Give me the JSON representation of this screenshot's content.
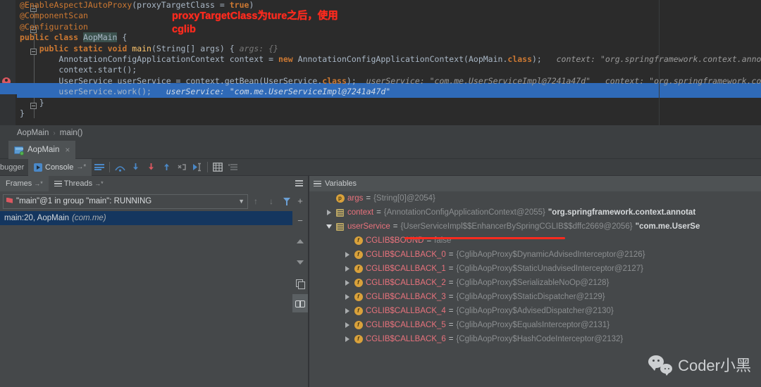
{
  "editor": {
    "lines": [
      {
        "type": "code",
        "tokens": [
          {
            "t": "@EnableAspectJAutoProxy",
            "c": "ann"
          },
          {
            "t": "(proxyTargetClass = ",
            "c": "cls"
          },
          {
            "t": "true",
            "c": "kw"
          },
          {
            "t": ")",
            "c": "cls"
          }
        ],
        "indent": 0
      },
      {
        "type": "code",
        "tokens": [
          {
            "t": "@ComponentScan",
            "c": "ann"
          }
        ],
        "indent": 0
      },
      {
        "type": "code",
        "tokens": [
          {
            "t": "@Configuration",
            "c": "ann"
          }
        ],
        "indent": 0
      },
      {
        "type": "code",
        "tokens": [
          {
            "t": "public class ",
            "c": "kw"
          },
          {
            "t": "AopMain",
            "c": "idh"
          },
          {
            "t": " {",
            "c": "cls"
          }
        ],
        "indent": 0
      },
      {
        "type": "code",
        "tokens": [
          {
            "t": "public static void ",
            "c": "kw"
          },
          {
            "t": "main",
            "c": "fn"
          },
          {
            "t": "(String[] args) { ",
            "c": "cls"
          },
          {
            "t": "args: {}",
            "c": "hint"
          }
        ],
        "indent": 1
      },
      {
        "type": "code",
        "tokens": [
          {
            "t": "AnnotationConfigApplicationContext context = ",
            "c": "cls"
          },
          {
            "t": "new ",
            "c": "kw"
          },
          {
            "t": "AnnotationConfigApplicationContext(AopMain.",
            "c": "cls"
          },
          {
            "t": "class",
            "c": "kw"
          },
          {
            "t": "); ",
            "c": "cls"
          },
          {
            "t": "  context: \"org.springframework.context.annota",
            "c": "hint-w"
          }
        ],
        "indent": 2
      },
      {
        "type": "code",
        "tokens": [
          {
            "t": "context.start();",
            "c": "cls"
          }
        ],
        "indent": 2
      },
      {
        "type": "code",
        "tokens": [
          {
            "t": "UserService userService = context.getBean(UserService.",
            "c": "cls"
          },
          {
            "t": "class",
            "c": "kw"
          },
          {
            "t": "); ",
            "c": "cls"
          },
          {
            "t": " userService: \"com.me.UserServiceImpl@7241a47d\"   context: \"org.springframework.cont",
            "c": "hint-w"
          }
        ],
        "indent": 2
      },
      {
        "type": "highlight",
        "tokens": [
          {
            "t": "userService.work();",
            "c": "cls"
          },
          {
            "t": "   userService: \"com.me.UserServiceImpl@7241a47d\"",
            "c": "hlhint"
          }
        ],
        "indent": 2
      },
      {
        "type": "code",
        "tokens": [
          {
            "t": "}",
            "c": "cls"
          }
        ],
        "indent": 1
      },
      {
        "type": "code",
        "tokens": [
          {
            "t": "}",
            "c": "cls"
          }
        ],
        "indent": 0
      }
    ],
    "annotation": "proxyTargetClass为ture之后，使用\ncglib"
  },
  "breadcrumb": {
    "class_name": "AopMain",
    "separator": "›",
    "method_name": "main()"
  },
  "file_tab": {
    "label": "AopMain",
    "close": "×"
  },
  "debug_toolbar": {
    "left_tab_label": "bugger",
    "console_label": "Console",
    "console_pin": "→*",
    "icons": [
      "lines-icon",
      "step-over-icon",
      "step-into-icon",
      "force-step-into-icon",
      "step-out-icon",
      "drop-frame-icon",
      "run-to-cursor-icon",
      "evaluate-expression-icon",
      "mute-breakpoints-icon"
    ]
  },
  "frames_panel": {
    "tabs": [
      {
        "label": "Frames",
        "pin": "→*",
        "active": true
      },
      {
        "label": "Threads",
        "pin": "→*",
        "active": false
      }
    ],
    "thread_selector": "\"main\"@1 in group \"main\": RUNNING",
    "frame_row": {
      "location": "main:20, AopMain",
      "package": "(com.me)"
    },
    "side_buttons": [
      "+",
      "−",
      "up-arrow",
      "down-arrow",
      "copy-icon",
      "glasses-icon"
    ]
  },
  "variables_panel": {
    "title": "Variables",
    "rows": [
      {
        "indent": 1,
        "expander": "none",
        "icon": "p",
        "name": "args",
        "eq": "=",
        "value": "{String[0]@2054}",
        "string": ""
      },
      {
        "indent": 1,
        "expander": "collapsed",
        "icon": "obj",
        "name": "context",
        "eq": "=",
        "value": "{AnnotationConfigApplicationContext@2055}",
        "string": "\"org.springframework.context.annotat"
      },
      {
        "indent": 1,
        "expander": "expanded",
        "icon": "obj",
        "name": "userService",
        "eq": "=",
        "value": "{UserServiceImpl$$EnhancerBySpringCGLIB$$dffc2669@2056}",
        "string": "\"com.me.UserSe"
      },
      {
        "indent": 2,
        "expander": "none",
        "icon": "f",
        "name": "CGLIB$BOUND",
        "eq": "=",
        "value": "false",
        "string": ""
      },
      {
        "indent": 2,
        "expander": "collapsed",
        "icon": "f",
        "name": "CGLIB$CALLBACK_0",
        "eq": "=",
        "value": "{CglibAopProxy$DynamicAdvisedInterceptor@2126}",
        "string": ""
      },
      {
        "indent": 2,
        "expander": "collapsed",
        "icon": "f",
        "name": "CGLIB$CALLBACK_1",
        "eq": "=",
        "value": "{CglibAopProxy$StaticUnadvisedInterceptor@2127}",
        "string": ""
      },
      {
        "indent": 2,
        "expander": "collapsed",
        "icon": "f",
        "name": "CGLIB$CALLBACK_2",
        "eq": "=",
        "value": "{CglibAopProxy$SerializableNoOp@2128}",
        "string": ""
      },
      {
        "indent": 2,
        "expander": "collapsed",
        "icon": "f",
        "name": "CGLIB$CALLBACK_3",
        "eq": "=",
        "value": "{CglibAopProxy$StaticDispatcher@2129}",
        "string": ""
      },
      {
        "indent": 2,
        "expander": "collapsed",
        "icon": "f",
        "name": "CGLIB$CALLBACK_4",
        "eq": "=",
        "value": "{CglibAopProxy$AdvisedDispatcher@2130}",
        "string": ""
      },
      {
        "indent": 2,
        "expander": "collapsed",
        "icon": "f",
        "name": "CGLIB$CALLBACK_5",
        "eq": "=",
        "value": "{CglibAopProxy$EqualsInterceptor@2131}",
        "string": ""
      },
      {
        "indent": 2,
        "expander": "collapsed",
        "icon": "f",
        "name": "CGLIB$CALLBACK_6",
        "eq": "=",
        "value": "{CglibAopProxy$HashCodeInterceptor@2132}",
        "string": ""
      }
    ]
  },
  "watermark": {
    "text": "Coder小黑",
    "icon": "wechat-icon"
  },
  "colors": {
    "editor_bg": "#2b2b2b",
    "panel_bg": "#45484a",
    "chrome_bg": "#3c3f41",
    "selection_blue": "#2f6ab8",
    "frame_selected": "#14365f",
    "annotation_red": "#ff2a1e",
    "var_name_red": "#e8727c",
    "keyword_orange": "#cc7832"
  }
}
